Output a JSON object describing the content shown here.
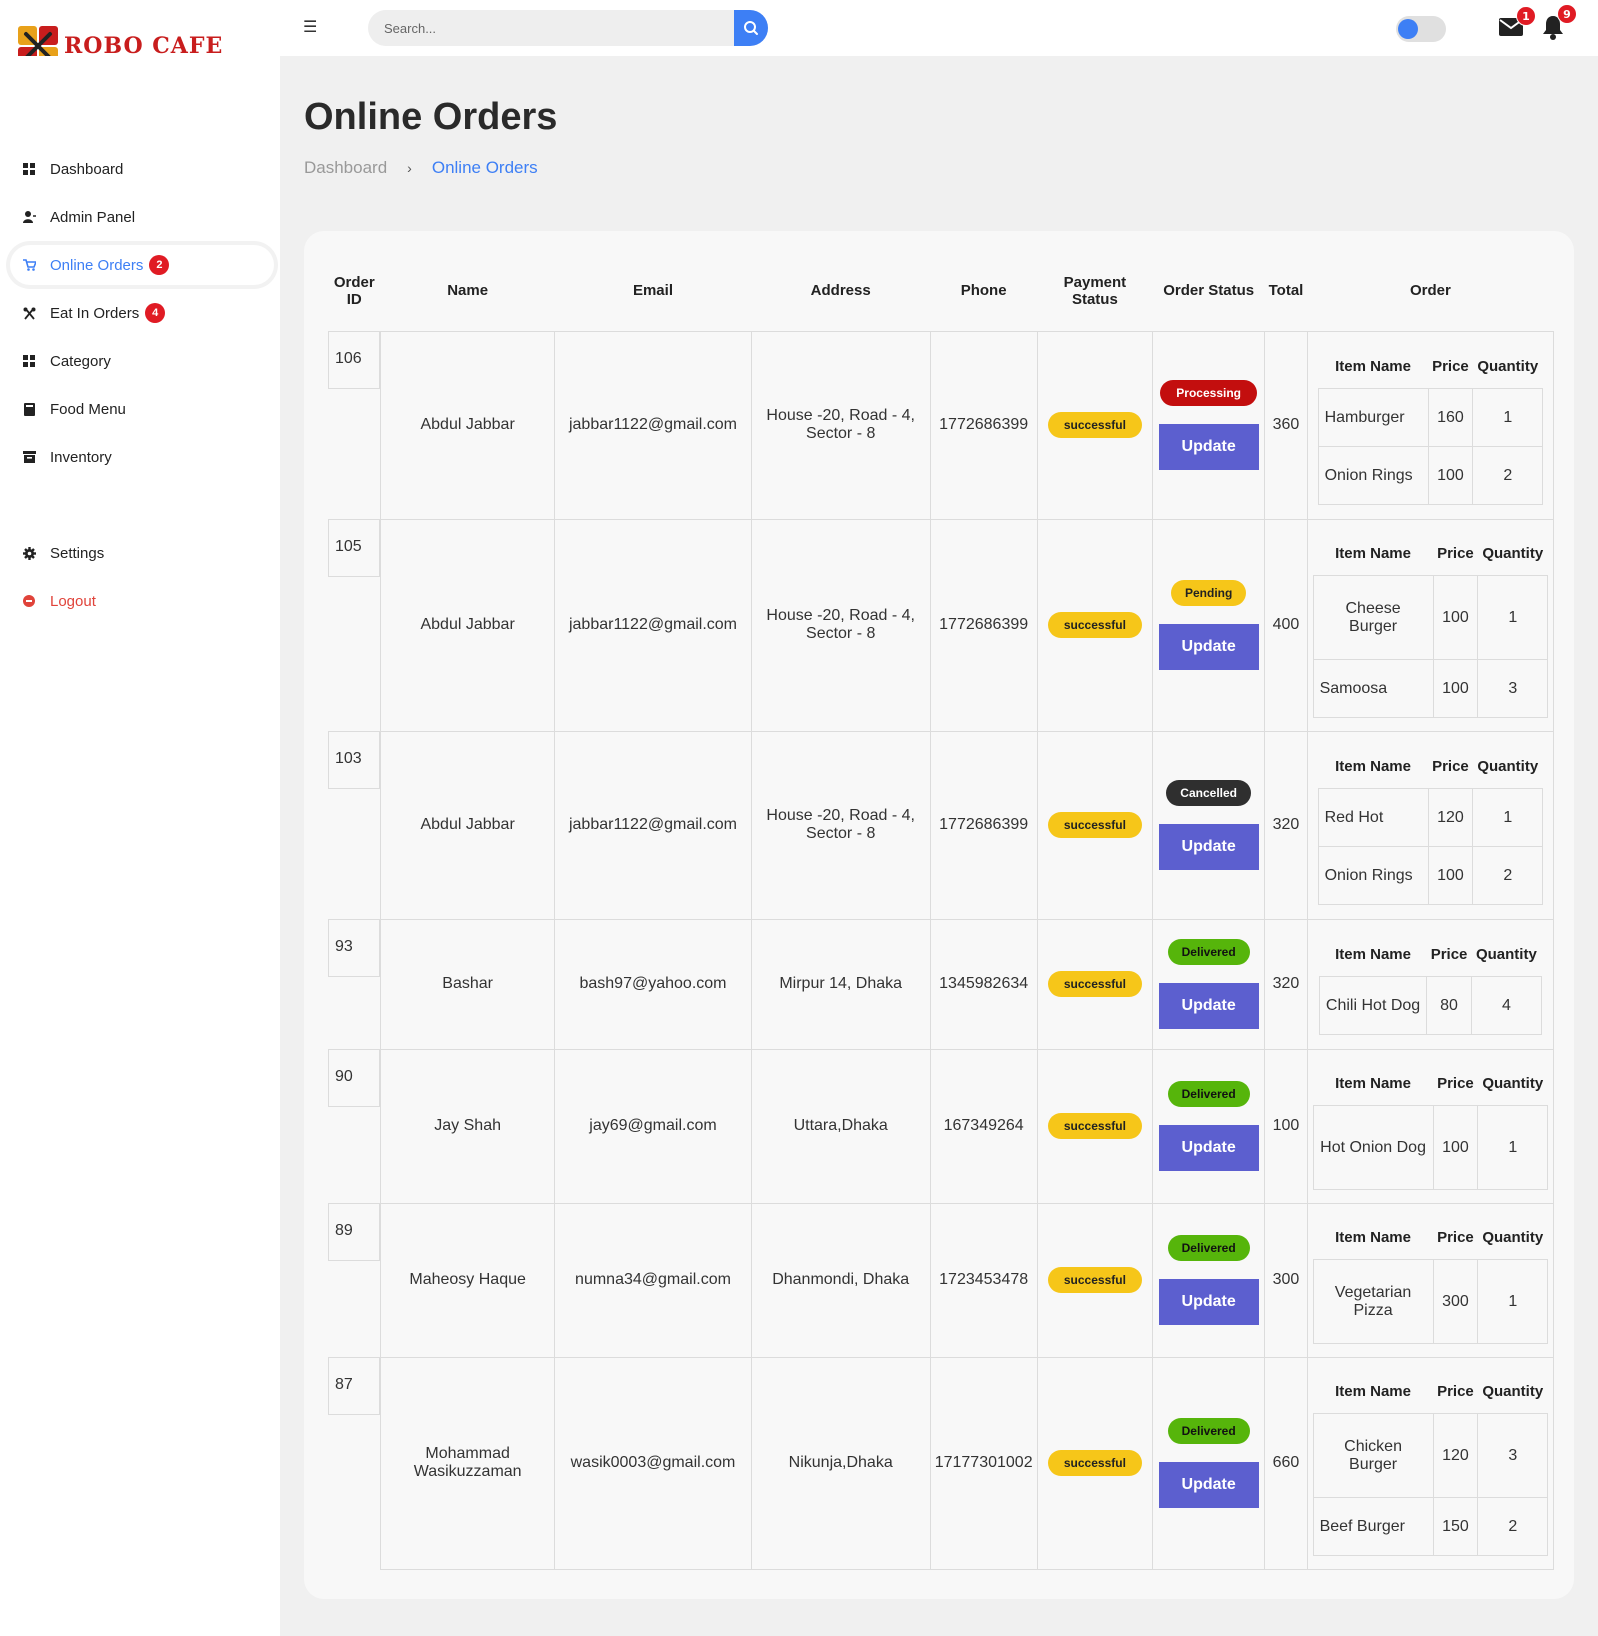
{
  "brand": {
    "name": "ROBO CAFE"
  },
  "search": {
    "placeholder": "Search..."
  },
  "header": {
    "mail_count": "1",
    "notification_count": "9"
  },
  "sidebar": {
    "items": [
      {
        "label": "Dashboard",
        "icon": "grid-icon"
      },
      {
        "label": "Admin Panel",
        "icon": "user-icon"
      },
      {
        "label": "Online Orders",
        "icon": "cart-icon",
        "badge": "2"
      },
      {
        "label": "Eat In Orders",
        "icon": "restaurant-icon",
        "badge": "4"
      },
      {
        "label": "Category",
        "icon": "grid-icon"
      },
      {
        "label": "Food Menu",
        "icon": "book-icon"
      },
      {
        "label": "Inventory",
        "icon": "archive-icon"
      },
      {
        "label": "Settings",
        "icon": "gear-icon"
      },
      {
        "label": "Logout",
        "icon": "logout-icon"
      }
    ]
  },
  "page": {
    "title": "Online Orders",
    "breadcrumb": {
      "home": "Dashboard",
      "current": "Online Orders"
    }
  },
  "table": {
    "headers": {
      "order_id": "Order ID",
      "name": "Name",
      "email": "Email",
      "address": "Address",
      "phone": "Phone",
      "payment_status": "Payment Status",
      "order_status": "Order Status",
      "total": "Total",
      "order": "Order"
    },
    "item_headers": {
      "item_name": "Item Name",
      "price": "Price",
      "quantity": "Quantity"
    },
    "update_label": "Update",
    "rows": [
      {
        "id": "106",
        "name": "Abdul Jabbar",
        "email": "jabbar1122@gmail.com",
        "address": "House -20, Road - 4, Sector - 8",
        "phone": "1772686399",
        "payment": "successful",
        "status": "Processing",
        "total": "360",
        "items": [
          {
            "name": "Hamburger",
            "price": "160",
            "qty": "1"
          },
          {
            "name": "Onion Rings",
            "price": "100",
            "qty": "2"
          }
        ]
      },
      {
        "id": "105",
        "name": "Abdul Jabbar",
        "email": "jabbar1122@gmail.com",
        "address": "House -20, Road - 4, Sector - 8",
        "phone": "1772686399",
        "payment": "successful",
        "status": "Pending",
        "total": "400",
        "items": [
          {
            "name": "Cheese Burger",
            "price": "100",
            "qty": "1"
          },
          {
            "name": "Samoosa",
            "price": "100",
            "qty": "3"
          }
        ]
      },
      {
        "id": "103",
        "name": "Abdul Jabbar",
        "email": "jabbar1122@gmail.com",
        "address": "House -20, Road - 4, Sector - 8",
        "phone": "1772686399",
        "payment": "successful",
        "status": "Cancelled",
        "total": "320",
        "items": [
          {
            "name": "Red Hot",
            "price": "120",
            "qty": "1"
          },
          {
            "name": "Onion Rings",
            "price": "100",
            "qty": "2"
          }
        ]
      },
      {
        "id": "93",
        "name": "Bashar",
        "email": "bash97@yahoo.com",
        "address": "Mirpur 14, Dhaka",
        "phone": "1345982634",
        "payment": "successful",
        "status": "Delivered",
        "total": "320",
        "items": [
          {
            "name": "Chili Hot Dog",
            "price": "80",
            "qty": "4"
          }
        ]
      },
      {
        "id": "90",
        "name": "Jay Shah",
        "email": "jay69@gmail.com",
        "address": "Uttara,Dhaka",
        "phone": "167349264",
        "payment": "successful",
        "status": "Delivered",
        "total": "100",
        "items": [
          {
            "name": "Hot Onion Dog",
            "price": "100",
            "qty": "1"
          }
        ]
      },
      {
        "id": "89",
        "name": "Maheosy Haque",
        "email": "numna34@gmail.com",
        "address": "Dhanmondi, Dhaka",
        "phone": "1723453478",
        "payment": "successful",
        "status": "Delivered",
        "total": "300",
        "items": [
          {
            "name": "Vegetarian Pizza",
            "price": "300",
            "qty": "1"
          }
        ]
      },
      {
        "id": "87",
        "name": "Mohammad Wasikuzzaman",
        "email": "wasik0003@gmail.com",
        "address": "Nikunja,Dhaka",
        "phone": "17177301002",
        "payment": "successful",
        "status": "Delivered",
        "total": "660",
        "items": [
          {
            "name": "Chicken Burger",
            "price": "120",
            "qty": "3"
          },
          {
            "name": "Beef Burger",
            "price": "150",
            "qty": "2"
          }
        ]
      }
    ]
  },
  "colors": {
    "accent": "#3d7ff5",
    "badge": "#e01b24",
    "update_button": "#5c5fcf",
    "payment_badge": "#f6c619",
    "processing": "#c30e0e",
    "pending": "#f6c619",
    "cancelled": "#2f2f2f",
    "delivered": "#56b50b"
  }
}
